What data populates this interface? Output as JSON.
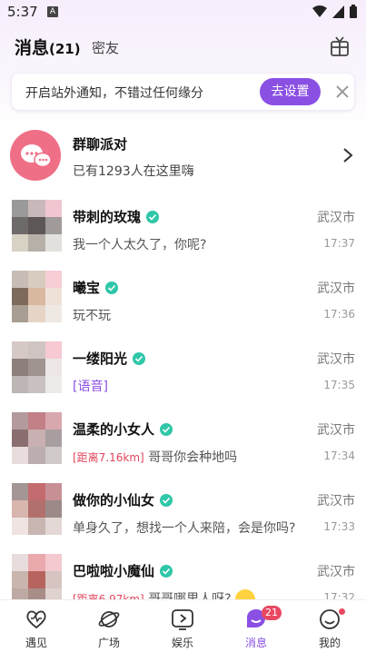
{
  "status_bar": {
    "time": "5:37",
    "indicator": "A"
  },
  "header": {
    "title": "消息",
    "count": "(21)",
    "tab2": "密友",
    "icon": "gift-icon"
  },
  "notice": {
    "text": "开启站外通知，不错过任何缘分",
    "button": "去设置",
    "close_icon": "close-icon"
  },
  "group": {
    "title": "群聊派对",
    "subtitle": "已有1293人在这里嗨"
  },
  "messages": [
    {
      "name": "带刺的玫瑰",
      "city": "武汉市",
      "preview": "我一个人太久了，你呢?",
      "time": "17:37"
    },
    {
      "name": "曦宝",
      "city": "武汉市",
      "preview": "玩不玩",
      "time": "17:36"
    },
    {
      "name": "一缕阳光",
      "city": "武汉市",
      "preview": "[语音]",
      "time": "17:35"
    },
    {
      "name": "温柔的小女人",
      "city": "武汉市",
      "distance": "[距离7.16km]",
      "preview": "哥哥你会种地吗",
      "time": "17:34"
    },
    {
      "name": "做你的小仙女",
      "city": "武汉市",
      "preview": "单身久了，想找一个人来陪，会是你吗?",
      "time": "17:33"
    },
    {
      "name": "巴啦啦小魔仙",
      "city": "武汉市",
      "distance": "[距离6.97km]",
      "preview": "哥哥哪里人呀?",
      "time": "17:32"
    }
  ],
  "nav": [
    {
      "label": "遇见",
      "icon": "heart-icon"
    },
    {
      "label": "广场",
      "icon": "planet-icon"
    },
    {
      "label": "娱乐",
      "icon": "play-icon"
    },
    {
      "label": "消息",
      "icon": "message-icon",
      "badge": "21",
      "active": true
    },
    {
      "label": "我的",
      "icon": "smile-icon"
    }
  ],
  "colors": {
    "accent": "#8a4fe3",
    "badge": "#e84861",
    "verified": "#2fc7a8",
    "group_avatar": "#ef6f86"
  }
}
